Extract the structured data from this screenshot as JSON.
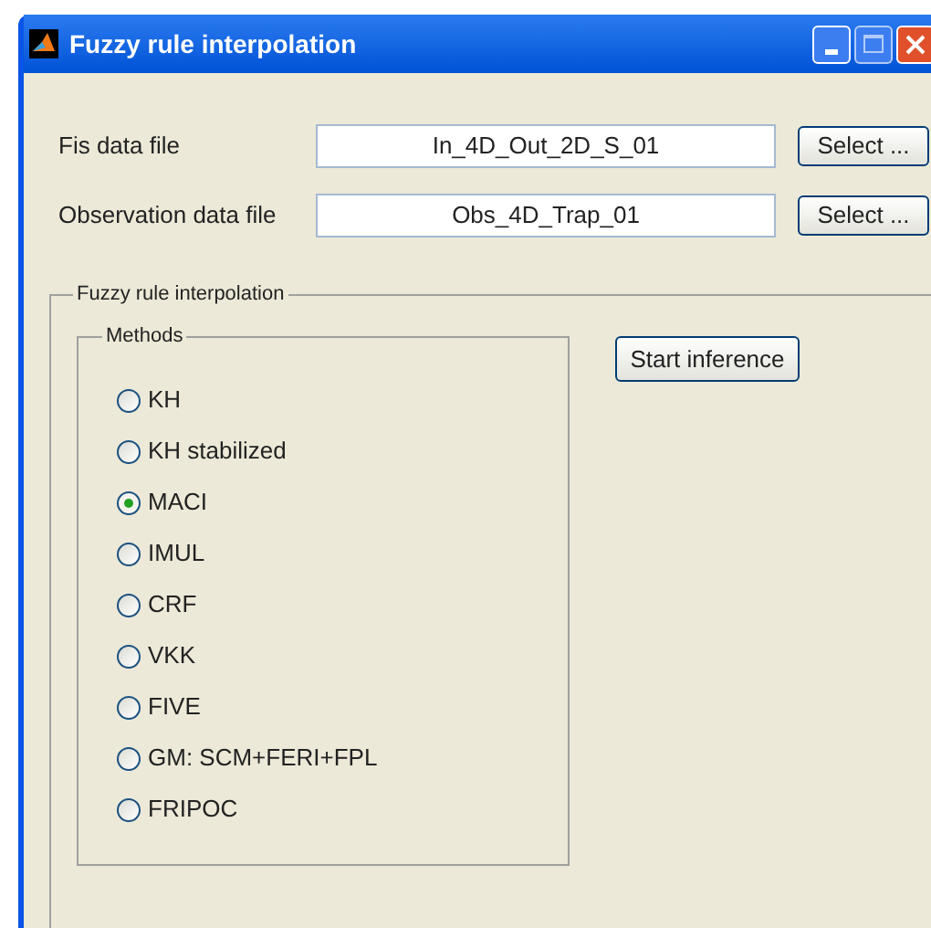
{
  "window": {
    "title": "Fuzzy rule interpolation"
  },
  "files": [
    {
      "label": "Fis data file",
      "value": "In_4D_Out_2D_S_01",
      "button": "Select ..."
    },
    {
      "label": "Observation data file",
      "value": "Obs_4D_Trap_01",
      "button": "Select ..."
    }
  ],
  "group": {
    "title": "Fuzzy rule interpolation",
    "methods_title": "Methods",
    "methods": [
      {
        "label": "KH",
        "selected": false
      },
      {
        "label": "KH stabilized",
        "selected": false
      },
      {
        "label": "MACI",
        "selected": true
      },
      {
        "label": "IMUL",
        "selected": false
      },
      {
        "label": "CRF",
        "selected": false
      },
      {
        "label": "VKK",
        "selected": false
      },
      {
        "label": "FIVE",
        "selected": false
      },
      {
        "label": "GM: SCM+FERI+FPL",
        "selected": false
      },
      {
        "label": "FRIPOC",
        "selected": false
      }
    ],
    "action": "Start inference"
  }
}
